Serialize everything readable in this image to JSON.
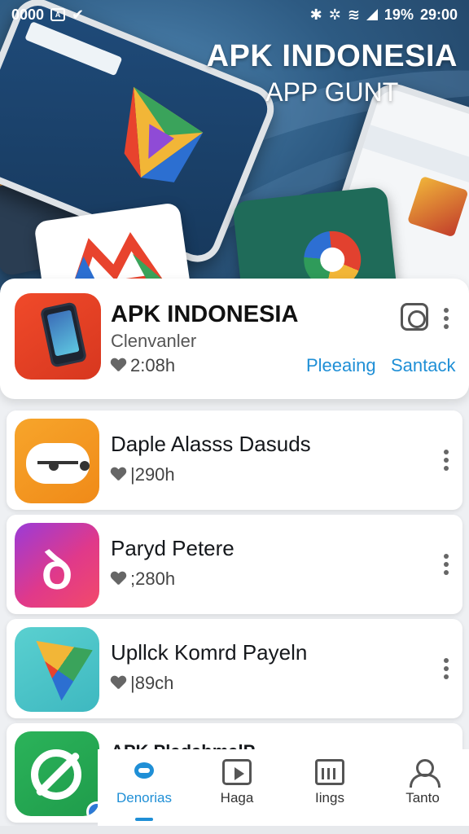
{
  "status_bar": {
    "left_text": "0000",
    "battery": "19%",
    "time": "29:00"
  },
  "hero": {
    "title": "APK INDONESIA",
    "subtitle": "APP GUNT"
  },
  "featured": {
    "title": "APK INDONESIA",
    "subtitle": "Clenvanler",
    "meta": "2:08h",
    "link_primary": "Pleeaing",
    "link_secondary": "Santack",
    "icons": {
      "action": "camera-icon",
      "menu": "kebab-menu-icon"
    }
  },
  "list": [
    {
      "title": "Daple Alasss Dasuds",
      "meta": "|290h",
      "icon": "orange-face-icon"
    },
    {
      "title": "Paryd Petere",
      "meta": ";280h",
      "icon": "purple-glyph-icon"
    },
    {
      "title": "Upllck Komrd Payeln",
      "meta": "|89ch",
      "icon": "teal-shape-icon"
    },
    {
      "title": "APK PladahmalP",
      "icon": "green-sync-icon"
    }
  ],
  "bottom_nav": {
    "items": [
      {
        "label": "Denorias",
        "icon": "chat-bubble-icon",
        "active": true
      },
      {
        "label": "Haga",
        "icon": "play-icon",
        "active": false
      },
      {
        "label": "Iings",
        "icon": "calendar-icon",
        "active": false
      },
      {
        "label": "Tanto",
        "icon": "user-icon",
        "active": false
      }
    ]
  },
  "colors": {
    "accent": "#1f8fd6",
    "hero_dark": "#1f3e5e",
    "card_bg": "#ffffff"
  }
}
